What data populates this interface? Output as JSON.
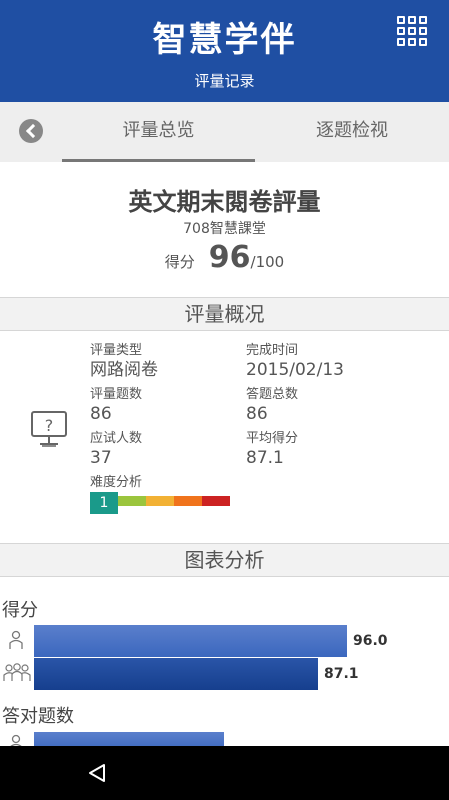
{
  "header": {
    "app_title": "智慧学伴",
    "page_subtitle": "评量记录",
    "menu_icon": "grid-icon"
  },
  "tabs": {
    "back_icon": "back-arrow-icon",
    "overview": "评量总览",
    "questions": "逐题检视"
  },
  "summary": {
    "exam_title": "英文期末閱卷評量",
    "class_name": "708智慧課堂",
    "score_label": "得分",
    "score_value": "96",
    "score_total": "/100"
  },
  "overview": {
    "section_title": "评量概况",
    "icon": "monitor-question-icon",
    "eval_type_label": "评量类型",
    "eval_type_value": "网路阅卷",
    "finish_time_label": "完成时间",
    "finish_time_value": "2015/02/13",
    "eval_count_label": "评量题数",
    "eval_count_value": "86",
    "answer_total_label": "答题总数",
    "answer_total_value": "86",
    "examinees_label": "应试人数",
    "examinees_value": "37",
    "avg_score_label": "平均得分",
    "avg_score_value": "87.1",
    "difficulty_label": "难度分析",
    "difficulty_value": "1",
    "difficulty_colors": [
      "#1a9a8a",
      "#9bc53d",
      "#f2b134",
      "#f0731c",
      "#cc2222"
    ]
  },
  "charts": {
    "section_title": "图表分析",
    "score_title": "得分",
    "correct_title": "答对题数"
  },
  "chart_data": {
    "type": "bar",
    "orientation": "horizontal",
    "title": "得分",
    "categories": [
      "个人",
      "平均"
    ],
    "values": [
      96.0,
      87.1
    ],
    "value_labels": [
      "96.0",
      "87.1"
    ],
    "xlim": [
      0,
      100
    ],
    "colors": [
      "#4a72c4",
      "#1f4a9c"
    ]
  },
  "navbar": {
    "back_icon": "nav-back-icon"
  }
}
